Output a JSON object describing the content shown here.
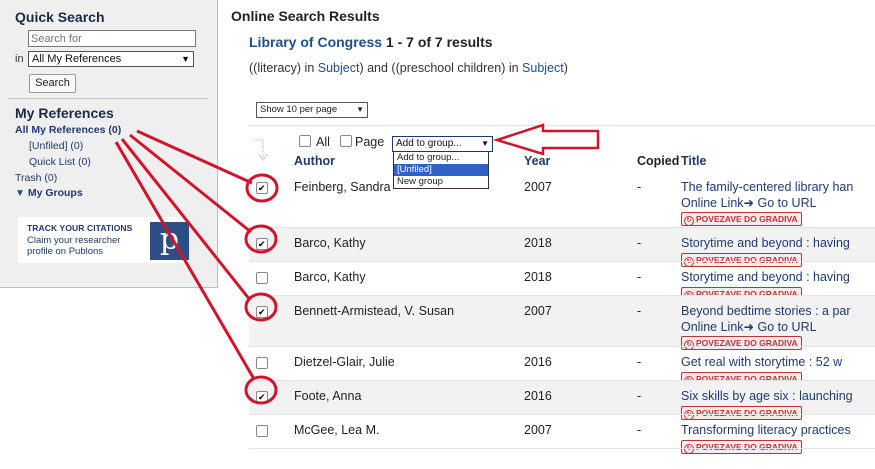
{
  "sidebar": {
    "quick_search_title": "Quick Search",
    "search_placeholder": "Search for",
    "in_label": "in",
    "scope_value": "All My References",
    "search_button": "Search",
    "my_references_title": "My References",
    "all_refs": "All My References (0)",
    "unfiled": "[Unfiled] (0)",
    "quick_list": "Quick List (0)",
    "trash": "Trash (0)",
    "my_groups": "My Groups",
    "publons": {
      "heading": "TRACK YOUR CITATIONS",
      "text": "Claim your researcher profile on Publons",
      "logo": "p"
    }
  },
  "main": {
    "title": "Online Search Results",
    "library": "Library of Congress",
    "count": "1 - 7 of 7 results",
    "query_prefix": "((literacy) in ",
    "query_subject1": "Subject",
    "query_mid": ") and ((preschool children) in ",
    "query_subject2": "Subject",
    "query_suffix": ")",
    "per_page": "Show 10 per page",
    "all_label": "All",
    "page_label": "Page",
    "add_group_value": "Add to group...",
    "group_options": [
      "Add to group...",
      "[Unfiled]",
      "New group"
    ],
    "columns": {
      "author": "Author",
      "year": "Year",
      "copied": "Copied",
      "title": "Title"
    },
    "online_link": "Online Link",
    "go_to_url": "Go to URL",
    "povezave": "POVEZAVE DO GRADIVA"
  },
  "rows": [
    {
      "author": "Feinberg, Sandra",
      "year": "2007",
      "copied": "-",
      "title": "The family-centered library han",
      "online": true,
      "checked": true
    },
    {
      "author": "Barco, Kathy",
      "year": "2018",
      "copied": "-",
      "title": "Storytime and beyond : having",
      "online": false,
      "checked": true
    },
    {
      "author": "Barco, Kathy",
      "year": "2018",
      "copied": "-",
      "title": "Storytime and beyond : having",
      "online": false,
      "checked": false
    },
    {
      "author": "Bennett-Armistead, V. Susan",
      "year": "2007",
      "copied": "-",
      "title": "Beyond bedtime stories : a par",
      "online": true,
      "checked": true
    },
    {
      "author": "Dietzel-Glair, Julie",
      "year": "2016",
      "copied": "-",
      "title": "Get real with storytime : 52 w",
      "online": false,
      "checked": false
    },
    {
      "author": "Foote, Anna",
      "year": "2016",
      "copied": "-",
      "title": "Six skills by age six : launching",
      "online": false,
      "checked": true
    },
    {
      "author": "McGee, Lea M.",
      "year": "2007",
      "copied": "-",
      "title": "Transforming literacy practices",
      "online": false,
      "checked": false
    }
  ],
  "colors": {
    "link": "#1f4f8a",
    "annotation": "#d0142b",
    "badge": "#b43838"
  }
}
